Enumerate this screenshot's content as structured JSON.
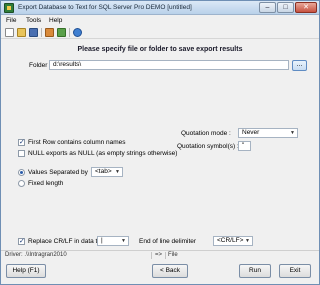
{
  "window": {
    "title": "Export Database to Text for SQL Server Pro DEMO [untitled]",
    "min_glyph": "–",
    "max_glyph": "□",
    "close_glyph": "✕"
  },
  "menu": [
    "File",
    "Tools",
    "Help"
  ],
  "toolbar": {
    "icons": [
      "new-icon",
      "open-icon",
      "save-icon",
      "wizard-icon",
      "export-icon",
      "help-icon"
    ]
  },
  "main": {
    "heading": "Please specify file or folder to save export results",
    "folder_label": "Folder",
    "folder_value": "d:\\results\\",
    "browse_label": "...",
    "quotation_mode_label": "Quotation mode :",
    "quotation_mode_value": "Never",
    "quotation_symbol_label": "Quotation symbol(s) :",
    "quotation_symbol_value": "\"",
    "first_row_label": "First Row contains column names",
    "first_row_checked": true,
    "null_exports_label": "NULL exports as NULL (as empty strings otherwise)",
    "null_exports_checked": false,
    "values_separated_label": "Values Separated by",
    "values_separated_value": "<tab>",
    "values_separated_selected": true,
    "fixed_length_label": "Fixed length",
    "fixed_length_selected": false,
    "replace_crlf_label": "Replace CR/LF in data to",
    "replace_crlf_checked": true,
    "replace_crlf_value": "|",
    "end_of_line_label": "End of line delimiter",
    "end_of_line_value": "<CR/LF>"
  },
  "status": {
    "driver": "Driver: .\\\\Intragran2010",
    "arrow": "=>",
    "target": "File"
  },
  "buttons": {
    "help": "Help (F1)",
    "back": "< Back",
    "run": "Run",
    "exit": "Exit"
  },
  "colors": {
    "title_bar": "#b9d1ea",
    "close_button": "#c65140",
    "dialog_bg": "#f0f0f0"
  }
}
